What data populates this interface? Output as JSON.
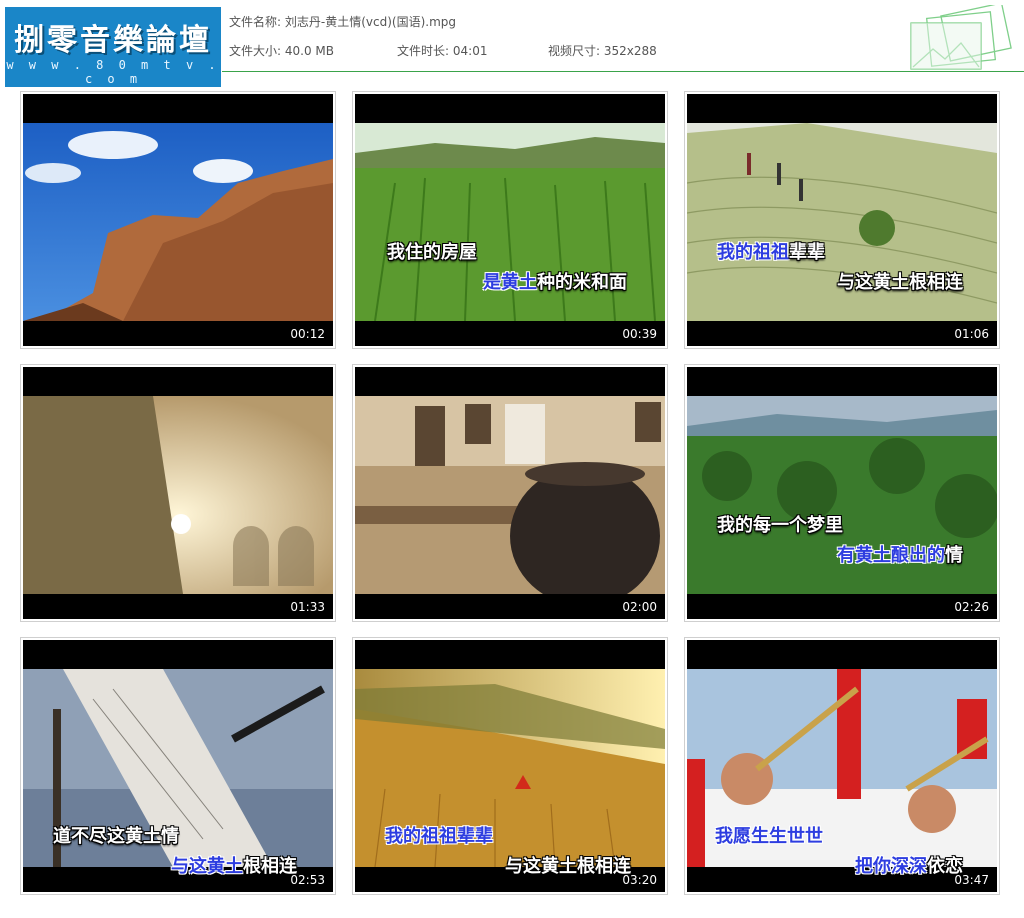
{
  "logo": {
    "title": "捌零音樂論壇",
    "url": "w w w . 8 0 m t v . c o m"
  },
  "file_info": {
    "name_label": "文件名称:",
    "name_value": "刘志丹-黄土情(vcd)(国语).mpg",
    "size_label": "文件大小:",
    "size_value": "40.0 MB",
    "duration_label": "文件时长:",
    "duration_value": "04:01",
    "dimensions_label": "视频尺寸:",
    "dimensions_value": "352x288"
  },
  "colors": {
    "header_line": "#3aa34a",
    "logo_bg": "#1a86c8",
    "lyric_blue": "#2d3de0"
  },
  "thumbnails": [
    {
      "timestamp": "00:12",
      "scene": "red-cliff-blue-sky",
      "lyrics": []
    },
    {
      "timestamp": "00:39",
      "scene": "corn-field",
      "lyrics": [
        {
          "text": "我住的房屋",
          "style": "white"
        },
        {
          "text": "是黄土",
          "style": "blue"
        },
        {
          "text": "种的米和面",
          "style": "white"
        }
      ]
    },
    {
      "timestamp": "01:06",
      "scene": "terraced-hill",
      "lyrics": [
        {
          "text": "我的祖祖",
          "style": "blue"
        },
        {
          "text": "辈辈",
          "style": "white"
        },
        {
          "text": "与这黄土根相连",
          "style": "white"
        }
      ]
    },
    {
      "timestamp": "01:33",
      "scene": "sunlit-cave-dwellings",
      "lyrics": []
    },
    {
      "timestamp": "02:00",
      "scene": "courtyard-water-jar",
      "lyrics": []
    },
    {
      "timestamp": "02:26",
      "scene": "green-hills",
      "lyrics": [
        {
          "text": "我的每一个梦里",
          "style": "white"
        },
        {
          "text": "有黄土酿出的",
          "style": "blue"
        },
        {
          "text": "情",
          "style": "white"
        }
      ]
    },
    {
      "timestamp": "02:53",
      "scene": "painter-easel",
      "lyrics": [
        {
          "text": "道不尽这黄土情",
          "style": "white"
        },
        {
          "text": "与这黄土",
          "style": "blue"
        },
        {
          "text": "根相连",
          "style": "white"
        }
      ]
    },
    {
      "timestamp": "03:20",
      "scene": "golden-wheat-field",
      "lyrics": [
        {
          "text": "我的祖祖辈辈",
          "style": "blue"
        },
        {
          "text": "与这黄土根相连",
          "style": "white"
        }
      ]
    },
    {
      "timestamp": "03:47",
      "scene": "suona-players",
      "lyrics": [
        {
          "text": "我愿生生世世",
          "style": "blue"
        },
        {
          "text": "把你深深",
          "style": "blue"
        },
        {
          "text": "依恋",
          "style": "white"
        }
      ]
    }
  ]
}
